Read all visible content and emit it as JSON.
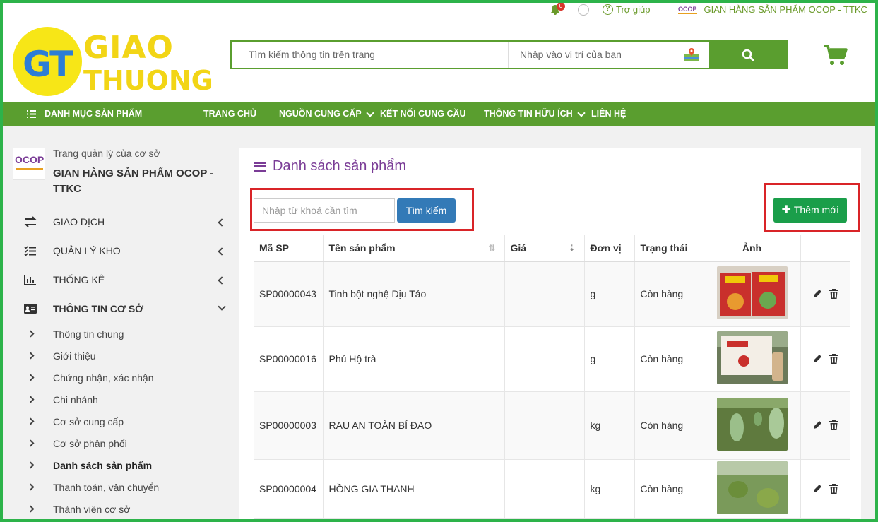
{
  "topbar": {
    "badge_count": "0",
    "help_label": "Trợ giúp",
    "shop_name": "GIAN HÀNG SẢN PHẨM OCOP - TTKC",
    "shop_logo_text": "OCOP"
  },
  "logo": {
    "initials": "GT",
    "line1": "GIAO",
    "line2": "THUONG"
  },
  "search": {
    "query_placeholder": "Tìm kiếm thông tin trên trang",
    "location_placeholder": "Nhập vào vị trí của bạn"
  },
  "nav": {
    "catalog": "DANH MỤC SẢN PHẨM",
    "home": "TRANG CHỦ",
    "suppliers": "NGUỒN CUNG CẤP",
    "connect": "KẾT NỐI CUNG CẦU",
    "info": "THÔNG TIN HỮU ÍCH",
    "contact": "LIÊN HỆ"
  },
  "sidebar": {
    "logo_text": "OCOP",
    "subtitle": "Trang quản lý của cơ sở",
    "shop_name": "GIAN HÀNG SẢN PHẨM OCOP - TTKC",
    "menu": [
      {
        "label": "GIAO DỊCH"
      },
      {
        "label": "QUẢN LÝ KHO"
      },
      {
        "label": "THỐNG KÊ"
      },
      {
        "label": "THÔNG TIN CƠ SỞ"
      }
    ],
    "submenu": [
      {
        "label": "Thông tin chung"
      },
      {
        "label": "Giới thiệu"
      },
      {
        "label": "Chứng nhận, xác nhận"
      },
      {
        "label": "Chi nhánh"
      },
      {
        "label": "Cơ sở cung cấp"
      },
      {
        "label": "Cơ sở phân phối"
      },
      {
        "label": "Danh sách sản phẩm"
      },
      {
        "label": "Thanh toán, vận chuyển"
      },
      {
        "label": "Thành viên cơ sở"
      }
    ]
  },
  "panel": {
    "title": "Danh sách sản phẩm",
    "keyword_placeholder": "Nhập từ khoá cần tìm",
    "search_button": "Tìm kiếm",
    "add_button": "Thêm mới"
  },
  "table": {
    "headers": [
      "Mã SP",
      "Tên sản phẩm",
      "Giá",
      "Đơn vị",
      "Trạng thái",
      "Ảnh",
      ""
    ],
    "rows": [
      {
        "code": "SP00000043",
        "name": "Tinh bột nghệ Dịu Tảo",
        "price": "",
        "unit": "g",
        "status": "Còn hàng",
        "image": "turmeric-box-photo"
      },
      {
        "code": "SP00000016",
        "name": "Phú Hộ trà",
        "price": "",
        "unit": "g",
        "status": "Còn hàng",
        "image": "tea-box-photo"
      },
      {
        "code": "SP00000003",
        "name": "RAU AN TOÀN BÍ ĐAO",
        "price": "",
        "unit": "kg",
        "status": "Còn hàng",
        "image": "winter-melon-photo"
      },
      {
        "code": "SP00000004",
        "name": "HỒNG GIA THANH",
        "price": "",
        "unit": "kg",
        "status": "Còn hàng",
        "image": "persimmon-photo"
      }
    ]
  },
  "colors": {
    "brand_green": "#5a9e2f",
    "title_purple": "#7a3c96",
    "add_green": "#1a9e4a",
    "search_blue": "#337ab7",
    "highlight_red": "#d92428"
  }
}
